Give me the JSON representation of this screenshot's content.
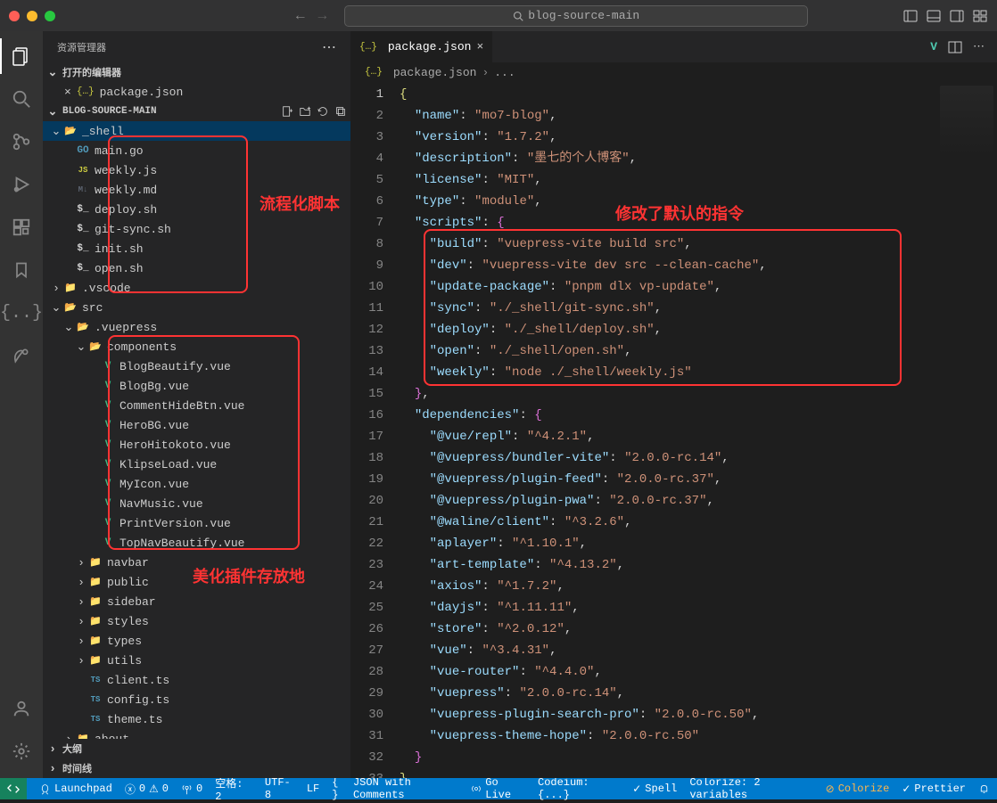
{
  "title_search": "blog-source-main",
  "sidebar": {
    "title": "资源管理器",
    "open_editors_label": "打开的编辑器",
    "project_label": "BLOG-SOURCE-MAIN",
    "outline_label": "大纲",
    "timeline_label": "时间线"
  },
  "tree": [
    {
      "d": 0,
      "t": "folder",
      "open": true,
      "name": "_shell",
      "active": true
    },
    {
      "d": 1,
      "t": "go",
      "name": "main.go"
    },
    {
      "d": 1,
      "t": "js",
      "name": "weekly.js"
    },
    {
      "d": 1,
      "t": "md",
      "name": "weekly.md"
    },
    {
      "d": 1,
      "t": "sh",
      "name": "deploy.sh"
    },
    {
      "d": 1,
      "t": "sh",
      "name": "git-sync.sh"
    },
    {
      "d": 1,
      "t": "sh",
      "name": "init.sh"
    },
    {
      "d": 1,
      "t": "sh",
      "name": "open.sh"
    },
    {
      "d": 0,
      "t": "folder",
      "open": false,
      "name": ".vscode"
    },
    {
      "d": 0,
      "t": "folder",
      "open": true,
      "name": "src",
      "ic": "other"
    },
    {
      "d": 1,
      "t": "folder",
      "open": true,
      "name": ".vuepress"
    },
    {
      "d": 2,
      "t": "folder",
      "open": true,
      "name": "components"
    },
    {
      "d": 3,
      "t": "vue",
      "name": "BlogBeautify.vue"
    },
    {
      "d": 3,
      "t": "vue",
      "name": "BlogBg.vue"
    },
    {
      "d": 3,
      "t": "vue",
      "name": "CommentHideBtn.vue"
    },
    {
      "d": 3,
      "t": "vue",
      "name": "HeroBG.vue"
    },
    {
      "d": 3,
      "t": "vue",
      "name": "HeroHitokoto.vue"
    },
    {
      "d": 3,
      "t": "vue",
      "name": "KlipseLoad.vue"
    },
    {
      "d": 3,
      "t": "vue",
      "name": "MyIcon.vue"
    },
    {
      "d": 3,
      "t": "vue",
      "name": "NavMusic.vue"
    },
    {
      "d": 3,
      "t": "vue",
      "name": "PrintVersion.vue"
    },
    {
      "d": 3,
      "t": "vue",
      "name": "TopNavBeautify.vue"
    },
    {
      "d": 2,
      "t": "folder",
      "open": false,
      "name": "navbar"
    },
    {
      "d": 2,
      "t": "folder",
      "open": false,
      "name": "public",
      "ic": "other"
    },
    {
      "d": 2,
      "t": "folder",
      "open": false,
      "name": "sidebar"
    },
    {
      "d": 2,
      "t": "folder",
      "open": false,
      "name": "styles"
    },
    {
      "d": 2,
      "t": "folder",
      "open": false,
      "name": "types"
    },
    {
      "d": 2,
      "t": "folder",
      "open": false,
      "name": "utils"
    },
    {
      "d": 2,
      "t": "ts",
      "name": "client.ts"
    },
    {
      "d": 2,
      "t": "ts",
      "name": "config.ts"
    },
    {
      "d": 2,
      "t": "ts",
      "name": "theme.ts"
    },
    {
      "d": 1,
      "t": "folder",
      "open": false,
      "name": "about"
    }
  ],
  "annotations": {
    "box1_label": "流程化脚本",
    "box2_label": "美化插件存放地",
    "editor_label": "修改了默认的指令"
  },
  "editor": {
    "tab_name": "package.json",
    "breadcrumb_file": "package.json",
    "breadcrumb_more": "..."
  },
  "code_lines": [
    [
      [
        "brace",
        "{"
      ]
    ],
    [
      [
        "sp",
        "  "
      ],
      [
        "key",
        "\"name\""
      ],
      [
        "punc",
        ": "
      ],
      [
        "str",
        "\"mo7-blog\""
      ],
      [
        "punc",
        ","
      ]
    ],
    [
      [
        "sp",
        "  "
      ],
      [
        "key",
        "\"version\""
      ],
      [
        "punc",
        ": "
      ],
      [
        "str",
        "\"1.7.2\""
      ],
      [
        "punc",
        ","
      ]
    ],
    [
      [
        "sp",
        "  "
      ],
      [
        "key",
        "\"description\""
      ],
      [
        "punc",
        ": "
      ],
      [
        "str",
        "\"墨七的个人博客\""
      ],
      [
        "punc",
        ","
      ]
    ],
    [
      [
        "sp",
        "  "
      ],
      [
        "key",
        "\"license\""
      ],
      [
        "punc",
        ": "
      ],
      [
        "str",
        "\"MIT\""
      ],
      [
        "punc",
        ","
      ]
    ],
    [
      [
        "sp",
        "  "
      ],
      [
        "key",
        "\"type\""
      ],
      [
        "punc",
        ": "
      ],
      [
        "str",
        "\"module\""
      ],
      [
        "punc",
        ","
      ]
    ],
    [
      [
        "sp",
        "  "
      ],
      [
        "key",
        "\"scripts\""
      ],
      [
        "punc",
        ": "
      ],
      [
        "brace2",
        "{"
      ]
    ],
    [
      [
        "sp",
        "    "
      ],
      [
        "key",
        "\"build\""
      ],
      [
        "punc",
        ": "
      ],
      [
        "str",
        "\"vuepress-vite build src\""
      ],
      [
        "punc",
        ","
      ]
    ],
    [
      [
        "sp",
        "    "
      ],
      [
        "key",
        "\"dev\""
      ],
      [
        "punc",
        ": "
      ],
      [
        "str",
        "\"vuepress-vite dev src --clean-cache\""
      ],
      [
        "punc",
        ","
      ]
    ],
    [
      [
        "sp",
        "    "
      ],
      [
        "key",
        "\"update-package\""
      ],
      [
        "punc",
        ": "
      ],
      [
        "str",
        "\"pnpm dlx vp-update\""
      ],
      [
        "punc",
        ","
      ]
    ],
    [
      [
        "sp",
        "    "
      ],
      [
        "key",
        "\"sync\""
      ],
      [
        "punc",
        ": "
      ],
      [
        "str",
        "\"./_shell/git-sync.sh\""
      ],
      [
        "punc",
        ","
      ]
    ],
    [
      [
        "sp",
        "    "
      ],
      [
        "key",
        "\"deploy\""
      ],
      [
        "punc",
        ": "
      ],
      [
        "str",
        "\"./_shell/deploy.sh\""
      ],
      [
        "punc",
        ","
      ]
    ],
    [
      [
        "sp",
        "    "
      ],
      [
        "key",
        "\"open\""
      ],
      [
        "punc",
        ": "
      ],
      [
        "str",
        "\"./_shell/open.sh\""
      ],
      [
        "punc",
        ","
      ]
    ],
    [
      [
        "sp",
        "    "
      ],
      [
        "key",
        "\"weekly\""
      ],
      [
        "punc",
        ": "
      ],
      [
        "str",
        "\"node ./_shell/weekly.js\""
      ]
    ],
    [
      [
        "sp",
        "  "
      ],
      [
        "brace2",
        "}"
      ],
      [
        "punc",
        ","
      ]
    ],
    [
      [
        "sp",
        "  "
      ],
      [
        "key",
        "\"dependencies\""
      ],
      [
        "punc",
        ": "
      ],
      [
        "brace2",
        "{"
      ]
    ],
    [
      [
        "sp",
        "    "
      ],
      [
        "key",
        "\"@vue/repl\""
      ],
      [
        "punc",
        ": "
      ],
      [
        "str",
        "\"^4.2.1\""
      ],
      [
        "punc",
        ","
      ]
    ],
    [
      [
        "sp",
        "    "
      ],
      [
        "key",
        "\"@vuepress/bundler-vite\""
      ],
      [
        "punc",
        ": "
      ],
      [
        "str",
        "\"2.0.0-rc.14\""
      ],
      [
        "punc",
        ","
      ]
    ],
    [
      [
        "sp",
        "    "
      ],
      [
        "key",
        "\"@vuepress/plugin-feed\""
      ],
      [
        "punc",
        ": "
      ],
      [
        "str",
        "\"2.0.0-rc.37\""
      ],
      [
        "punc",
        ","
      ]
    ],
    [
      [
        "sp",
        "    "
      ],
      [
        "key",
        "\"@vuepress/plugin-pwa\""
      ],
      [
        "punc",
        ": "
      ],
      [
        "str",
        "\"2.0.0-rc.37\""
      ],
      [
        "punc",
        ","
      ]
    ],
    [
      [
        "sp",
        "    "
      ],
      [
        "key",
        "\"@waline/client\""
      ],
      [
        "punc",
        ": "
      ],
      [
        "str",
        "\"^3.2.6\""
      ],
      [
        "punc",
        ","
      ]
    ],
    [
      [
        "sp",
        "    "
      ],
      [
        "key",
        "\"aplayer\""
      ],
      [
        "punc",
        ": "
      ],
      [
        "str",
        "\"^1.10.1\""
      ],
      [
        "punc",
        ","
      ]
    ],
    [
      [
        "sp",
        "    "
      ],
      [
        "key",
        "\"art-template\""
      ],
      [
        "punc",
        ": "
      ],
      [
        "str",
        "\"^4.13.2\""
      ],
      [
        "punc",
        ","
      ]
    ],
    [
      [
        "sp",
        "    "
      ],
      [
        "key",
        "\"axios\""
      ],
      [
        "punc",
        ": "
      ],
      [
        "str",
        "\"^1.7.2\""
      ],
      [
        "punc",
        ","
      ]
    ],
    [
      [
        "sp",
        "    "
      ],
      [
        "key",
        "\"dayjs\""
      ],
      [
        "punc",
        ": "
      ],
      [
        "str",
        "\"^1.11.11\""
      ],
      [
        "punc",
        ","
      ]
    ],
    [
      [
        "sp",
        "    "
      ],
      [
        "key",
        "\"store\""
      ],
      [
        "punc",
        ": "
      ],
      [
        "str",
        "\"^2.0.12\""
      ],
      [
        "punc",
        ","
      ]
    ],
    [
      [
        "sp",
        "    "
      ],
      [
        "key",
        "\"vue\""
      ],
      [
        "punc",
        ": "
      ],
      [
        "str",
        "\"^3.4.31\""
      ],
      [
        "punc",
        ","
      ]
    ],
    [
      [
        "sp",
        "    "
      ],
      [
        "key",
        "\"vue-router\""
      ],
      [
        "punc",
        ": "
      ],
      [
        "str",
        "\"^4.4.0\""
      ],
      [
        "punc",
        ","
      ]
    ],
    [
      [
        "sp",
        "    "
      ],
      [
        "key",
        "\"vuepress\""
      ],
      [
        "punc",
        ": "
      ],
      [
        "str",
        "\"2.0.0-rc.14\""
      ],
      [
        "punc",
        ","
      ]
    ],
    [
      [
        "sp",
        "    "
      ],
      [
        "key",
        "\"vuepress-plugin-search-pro\""
      ],
      [
        "punc",
        ": "
      ],
      [
        "str",
        "\"2.0.0-rc.50\""
      ],
      [
        "punc",
        ","
      ]
    ],
    [
      [
        "sp",
        "    "
      ],
      [
        "key",
        "\"vuepress-theme-hope\""
      ],
      [
        "punc",
        ": "
      ],
      [
        "str",
        "\"2.0.0-rc.50\""
      ]
    ],
    [
      [
        "sp",
        "  "
      ],
      [
        "brace2",
        "}"
      ]
    ],
    [
      [
        "brace",
        "}"
      ]
    ]
  ],
  "status": {
    "launchpad": "Launchpad",
    "errors": "0",
    "warnings": "0",
    "ports": "0",
    "spaces": "空格: 2",
    "encoding": "UTF-8",
    "eol": "LF",
    "lang": "JSON with Comments",
    "golive": "Go Live",
    "codeium": "Codeium: {...}",
    "spell": "Spell",
    "colorize_vars": "Colorize: 2 variables",
    "colorize": "Colorize",
    "prettier": "Prettier"
  }
}
